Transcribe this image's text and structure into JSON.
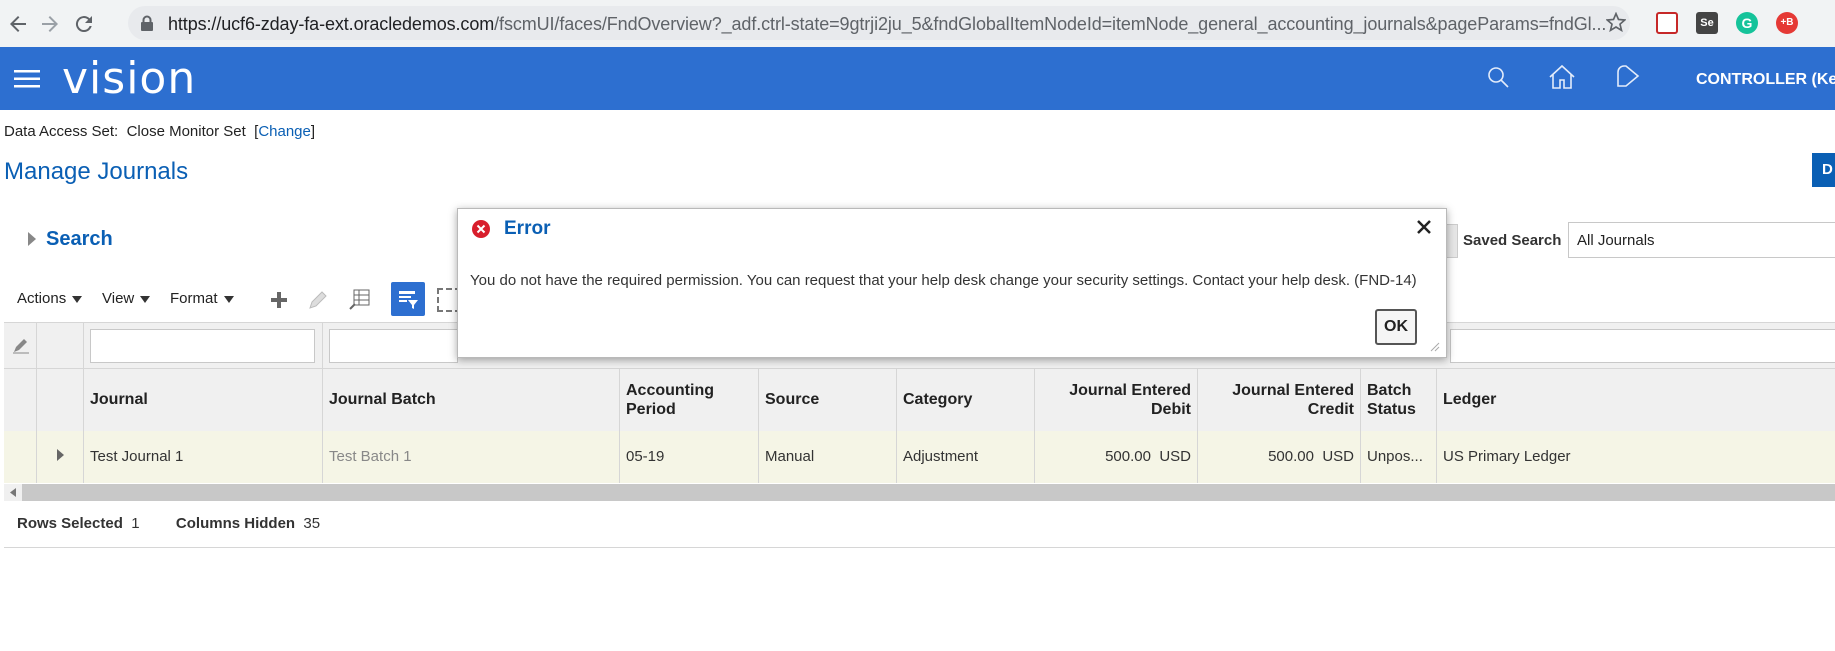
{
  "browser": {
    "url_main": "https://ucf6-zday-fa-ext.oracledemos.com",
    "url_rest": "/fscmUI/faces/FndOverview?_adf.ctrl-state=9gtrji2ju_5&fndGlobalItemNodeId=itemNode_general_accounting_journals&pageParams=fndGl..."
  },
  "header": {
    "brand": "vision",
    "user": "CONTROLLER (Ken"
  },
  "data_access": {
    "label": "Data Access Set:",
    "value": "Close Monitor Set",
    "bracket_open": "[",
    "change_link": "Change",
    "bracket_close": "]"
  },
  "page": {
    "title": "Manage Journals",
    "right_button_label": "D"
  },
  "search": {
    "label": "Search",
    "saved_search_label": "Saved Search",
    "saved_search_value": "All Journals"
  },
  "toolbar": {
    "actions": "Actions",
    "view": "View",
    "format": "Format"
  },
  "table": {
    "columns": [
      "Journal",
      "Journal Batch",
      "Accounting Period",
      "Source",
      "Category",
      "Journal Entered Debit",
      "Journal Entered Credit",
      "Batch Status",
      "Ledger"
    ],
    "column_lines": [
      [
        "Journal"
      ],
      [
        "Journal Batch"
      ],
      [
        "Accounting",
        "Period"
      ],
      [
        "Source"
      ],
      [
        "Category"
      ],
      [
        "Journal Entered",
        "Debit"
      ],
      [
        "Journal Entered",
        "Credit"
      ],
      [
        "Batch",
        "Status"
      ],
      [
        "Ledger"
      ]
    ],
    "rows": [
      {
        "journal": "Test Journal 1",
        "batch": "Test Batch 1",
        "period": "05-19",
        "source": "Manual",
        "category": "Adjustment",
        "debit": "500.00",
        "debit_currency": "USD",
        "credit": "500.00",
        "credit_currency": "USD",
        "status": "Unpos...",
        "ledger": "US Primary Ledger"
      }
    ]
  },
  "footer": {
    "rows_selected_label": "Rows Selected",
    "rows_selected_value": "1",
    "columns_hidden_label": "Columns Hidden",
    "columns_hidden_value": "35"
  },
  "dialog": {
    "title": "Error",
    "message": "You do not have the required permission. You can request that your help desk change your security settings. Contact your help desk. (FND-14)",
    "ok_label": "OK"
  },
  "colors": {
    "brand_blue": "#2d6fd0",
    "link_blue": "#0a5fb4",
    "error_red": "#d81e2c",
    "row_highlight": "#f5f5e6"
  },
  "icons": [
    "back-icon",
    "forward-icon",
    "reload-icon",
    "lock-icon",
    "star-icon",
    "menu-icon",
    "search-icon",
    "home-icon",
    "notification-icon",
    "close-icon",
    "error-icon",
    "add-icon",
    "edit-icon",
    "freeze-icon",
    "query-by-example-icon",
    "detach-icon",
    "expand-icon"
  ]
}
